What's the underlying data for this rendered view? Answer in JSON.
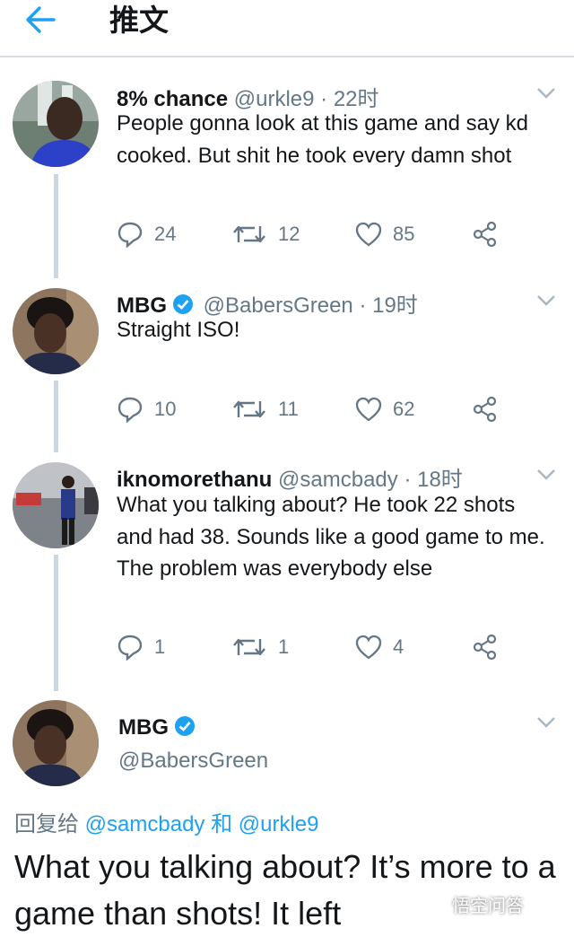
{
  "header": {
    "title": "推文"
  },
  "tweets": [
    {
      "name": "8% chance",
      "handle": "@urkle9",
      "time": "· 22时",
      "text": "People gonna look at this game and say kd cooked. But shit he took every damn shot",
      "replies": "24",
      "retweets": "12",
      "likes": "85"
    },
    {
      "name": "MBG",
      "handle": "@BabersGreen",
      "time": "· 19时",
      "text": "Straight ISO!",
      "replies": "10",
      "retweets": "11",
      "likes": "62"
    },
    {
      "name": "iknomorethanu",
      "handle": "@samcbady",
      "time": "· 18时",
      "text": "What you talking about? He took 22 shots and had 38. Sounds like a good game to me. The problem was everybody else",
      "replies": "1",
      "retweets": "1",
      "likes": "4"
    }
  ],
  "main_tweet": {
    "name": "MBG",
    "handle": "@BabersGreen",
    "replying_prefix": "回复给",
    "reply_to_1": "@samcbady",
    "reply_and": "和",
    "reply_to_2": "@urkle9",
    "text": "What you talking about? It’s more to a game than shots! It left"
  },
  "watermark": "悟空问答",
  "colors": {
    "accent": "#1da1f2",
    "muted": "#657786",
    "line": "#ccd6dd"
  }
}
